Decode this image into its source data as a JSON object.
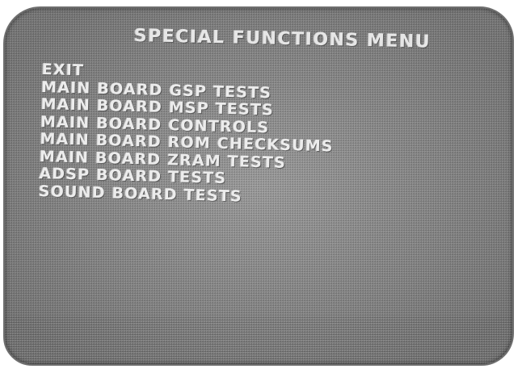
{
  "menu": {
    "title": "SPECIAL FUNCTIONS MENU",
    "items": [
      {
        "label": "EXIT"
      },
      {
        "label": "MAIN BOARD GSP TESTS"
      },
      {
        "label": "MAIN BOARD MSP TESTS"
      },
      {
        "label": "MAIN BOARD CONTROLS"
      },
      {
        "label": "MAIN BOARD ROM CHECKSUMS"
      },
      {
        "label": "MAIN BOARD ZRAM TESTS"
      },
      {
        "label": "ADSP BOARD TESTS"
      },
      {
        "label": "SOUND BOARD TESTS"
      }
    ]
  },
  "colors": {
    "screen_background": "#8f8f8f",
    "text": "#ececec"
  }
}
